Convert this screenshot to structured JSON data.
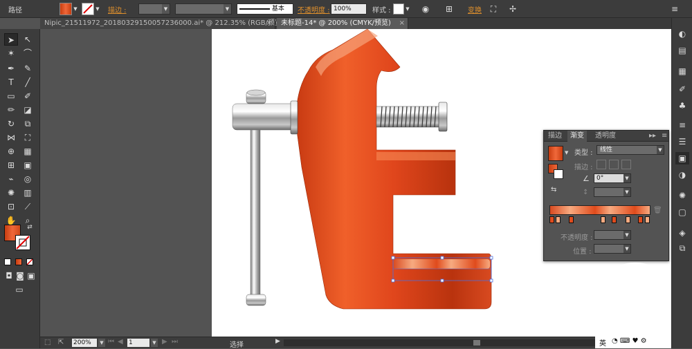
{
  "control_bar": {
    "object_type": "路径",
    "stroke_link": "描边 :",
    "stroke_profile": "基本",
    "opacity_link": "不透明度 :",
    "opacity_value": "100%",
    "style_label": "样式 :",
    "transform_link": "变换",
    "fill_icon": "orange-gradient-swatch",
    "stroke_icon": "none-swatch"
  },
  "tabs": [
    {
      "label": "Nipic_21511972_20180329150057236000.ai* @ 212.35% (RGB/预览)"
    },
    {
      "label": "未标题-14* @ 200% (CMYK/预览)"
    }
  ],
  "gradient_panel": {
    "tabs": [
      "描边",
      "渐变",
      "透明度"
    ],
    "type_label": "类型 :",
    "type_value": "线性",
    "stroke_label": "描边 :",
    "angle_value": "0°",
    "opacity_label": "不透明度 :",
    "location_label": "位置 :"
  },
  "status": {
    "zoom": "200%",
    "page": "1",
    "tool_name": "选择"
  },
  "colors": {
    "accent_orange": "#e0902c",
    "clamp_orange": "#e0461c",
    "chrome": "#b8b8b8"
  },
  "taskbar_hint": "英"
}
